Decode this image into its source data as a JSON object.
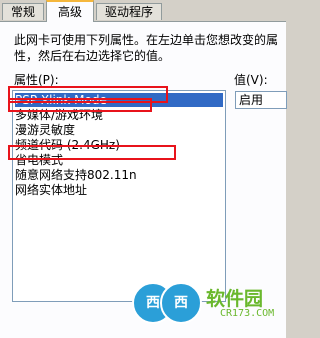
{
  "tabs": [
    {
      "label": "常规"
    },
    {
      "label": "高级",
      "active": true
    },
    {
      "label": "驱动程序"
    }
  ],
  "description": "此网卡可使用下列属性。在左边单击您想改变的属性，然后在右边选择它的值。",
  "property_label": "属性(P):",
  "value_label": "值(V):",
  "properties": [
    {
      "label": "PSP Xlink Mode",
      "selected": true
    },
    {
      "label": "多媒体/游戏环境"
    },
    {
      "label": "漫游灵敏度"
    },
    {
      "label": "频道代码 (2.4GHz)"
    },
    {
      "label": "省电模式"
    },
    {
      "label": "随意网络支持802.11n"
    },
    {
      "label": "网络实体地址"
    }
  ],
  "value_selected": "启用",
  "watermark": {
    "circle1": "西",
    "circle2": "西",
    "brand": "软件园",
    "url": "CR173.COM"
  },
  "colors": {
    "annotation": "#e8131b",
    "selection": "#316ac5",
    "tab_highlight": "#f5b73c"
  }
}
